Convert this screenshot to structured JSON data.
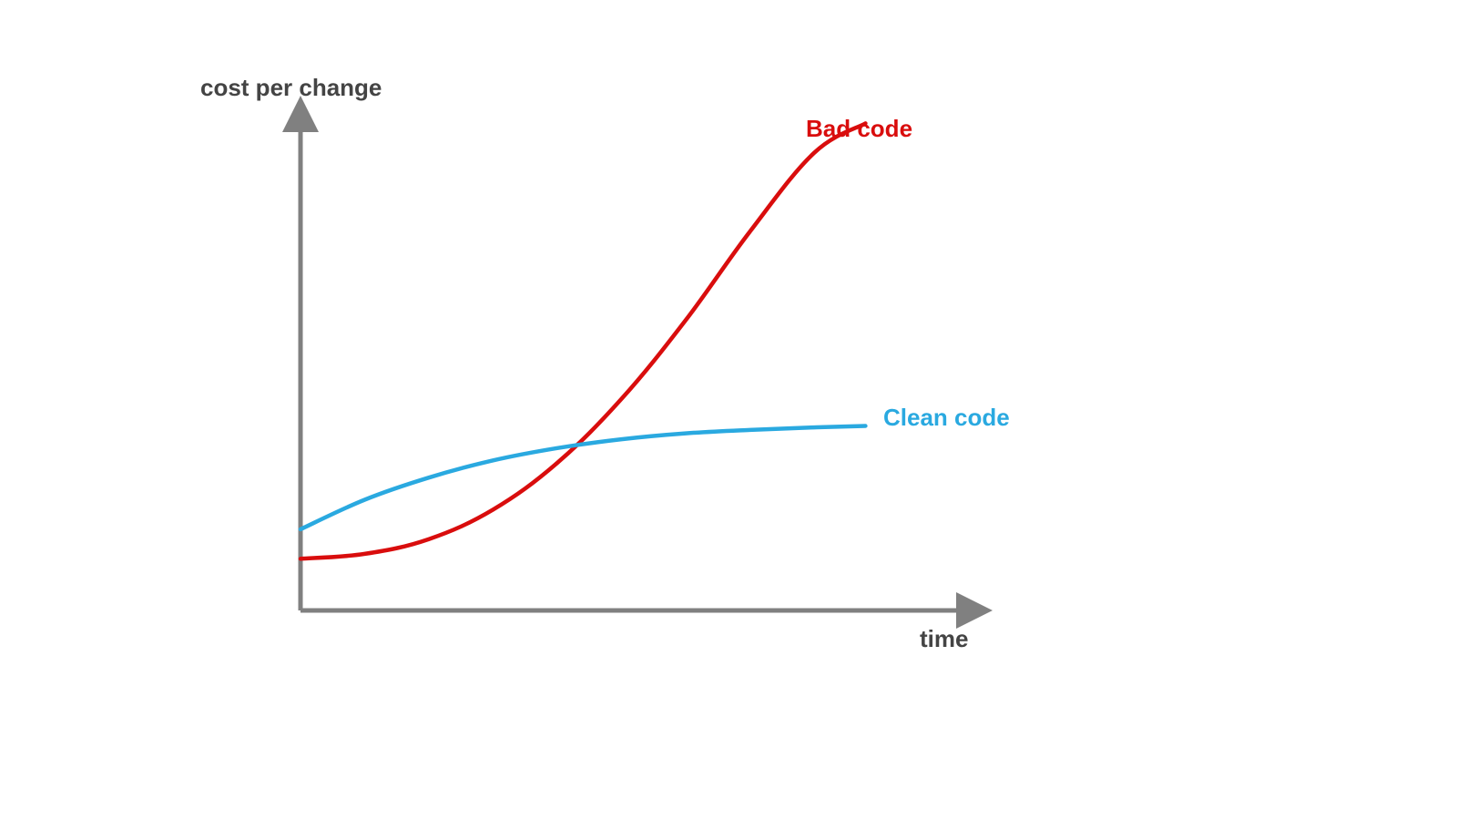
{
  "chart_data": {
    "type": "line",
    "xlabel": "time",
    "ylabel": "cost per change",
    "xlim": [
      0,
      10
    ],
    "ylim": [
      0,
      10
    ],
    "x": [
      0,
      1,
      2,
      3,
      4,
      5,
      6,
      7,
      8,
      8.8
    ],
    "series": [
      {
        "name": "Bad code",
        "color": "#d90d0d",
        "values": [
          1.05,
          1.15,
          1.45,
          2.05,
          3.0,
          4.3,
          5.9,
          7.7,
          9.3,
          9.9
        ]
      },
      {
        "name": "Clean code",
        "color": "#2aa9e0",
        "values": [
          1.65,
          2.25,
          2.7,
          3.05,
          3.3,
          3.48,
          3.6,
          3.67,
          3.72,
          3.75
        ]
      }
    ],
    "axis_color": "#808080",
    "grid": false,
    "legend_position": "right-inline"
  },
  "labels": {
    "y_title": "cost per change",
    "x_title": "time",
    "bad": "Bad code",
    "clean": "Clean code"
  }
}
